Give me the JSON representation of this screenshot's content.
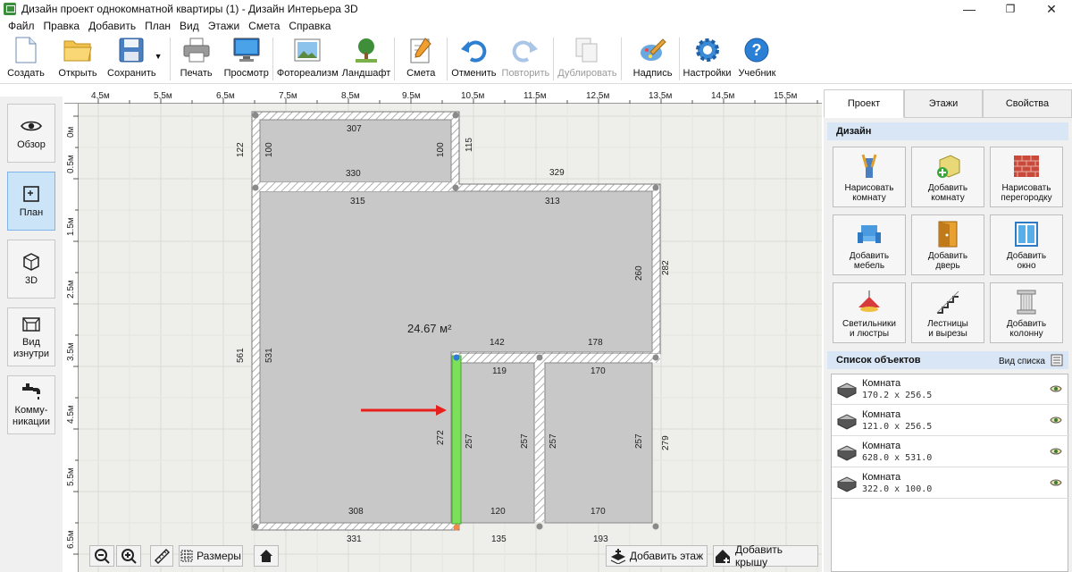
{
  "window": {
    "title": "Дизайн проект однокомнатной квартиры (1) - Дизайн Интерьера 3D",
    "controls": {
      "minimize": "—",
      "maximize": "❐",
      "close": "✕"
    }
  },
  "menu": [
    "Файл",
    "Правка",
    "Добавить",
    "План",
    "Вид",
    "Этажи",
    "Смета",
    "Справка"
  ],
  "toolbar": {
    "create": "Создать",
    "open": "Открыть",
    "save": "Сохранить",
    "print": "Печать",
    "preview": "Просмотр",
    "photorealism": "Фотореализм",
    "landscape": "Ландшафт",
    "estimate": "Смета",
    "undo": "Отменить",
    "redo": "Повторить",
    "duplicate": "Дублировать",
    "label": "Надпись",
    "settings": "Настройки",
    "tutorial": "Учебник"
  },
  "left_panel": {
    "overview": "Обзор",
    "plan": "План",
    "view3d": "3D",
    "inside_line1": "Вид",
    "inside_line2": "изнутри",
    "comm_line1": "Комму-",
    "comm_line2": "никации"
  },
  "ruler": {
    "top": [
      "4.5м",
      "5.5м",
      "6.5м",
      "7.5м",
      "8.5м",
      "9.5м",
      "10.5м",
      "11.5м",
      "12.5м",
      "13.5м",
      "14.5м",
      "15.5м"
    ],
    "left": [
      "0м",
      "0.5м",
      "1.5м",
      "2.5м",
      "3.5м",
      "4.5м",
      "5.5м",
      "6.5м"
    ]
  },
  "plan": {
    "area": "24.67 м²",
    "dims": {
      "d307": "307",
      "d122": "122",
      "d100a": "100",
      "d100b": "100",
      "d115": "115",
      "d330": "330",
      "d329": "329",
      "d315": "315",
      "d313": "313",
      "d260": "260",
      "d282": "282",
      "d561": "561",
      "d531": "531",
      "d142": "142",
      "d178": "178",
      "d119": "119",
      "d170a": "170",
      "d272": "272",
      "d257a": "257",
      "d257b": "257",
      "d257c": "257",
      "d257d": "257",
      "d279": "279",
      "d308": "308",
      "d120": "120",
      "d170b": "170",
      "d331": "331",
      "d135": "135",
      "d193": "193"
    }
  },
  "canvas_controls": {
    "sizes": "Размеры",
    "add_floor": "Добавить этаж",
    "add_roof": "Добавить крышу"
  },
  "right_panel": {
    "tabs": [
      "Проект",
      "Этажи",
      "Свойства"
    ],
    "design_header": "Дизайн",
    "design_items": [
      {
        "l1": "Нарисовать",
        "l2": "комнату"
      },
      {
        "l1": "Добавить",
        "l2": "комнату"
      },
      {
        "l1": "Нарисовать",
        "l2": "перегородку"
      },
      {
        "l1": "Добавить",
        "l2": "мебель"
      },
      {
        "l1": "Добавить",
        "l2": "дверь"
      },
      {
        "l1": "Добавить",
        "l2": "окно"
      },
      {
        "l1": "Светильники",
        "l2": "и люстры"
      },
      {
        "l1": "Лестницы",
        "l2": "и вырезы"
      },
      {
        "l1": "Добавить",
        "l2": "колонну"
      }
    ],
    "objects_header": "Список объектов",
    "list_view": "Вид списка",
    "objects": [
      {
        "name": "Комната",
        "size": "170.2 x 256.5"
      },
      {
        "name": "Комната",
        "size": "121.0 x 256.5"
      },
      {
        "name": "Комната",
        "size": "628.0 x 531.0"
      },
      {
        "name": "Комната",
        "size": "322.0 x 100.0"
      }
    ]
  },
  "colors": {
    "accent": "#cce4f7",
    "room_fill": "#c8c8c8",
    "selected_wall": "#7be05a",
    "arrow": "#e8201c",
    "section_header": "#d9e6f5"
  }
}
